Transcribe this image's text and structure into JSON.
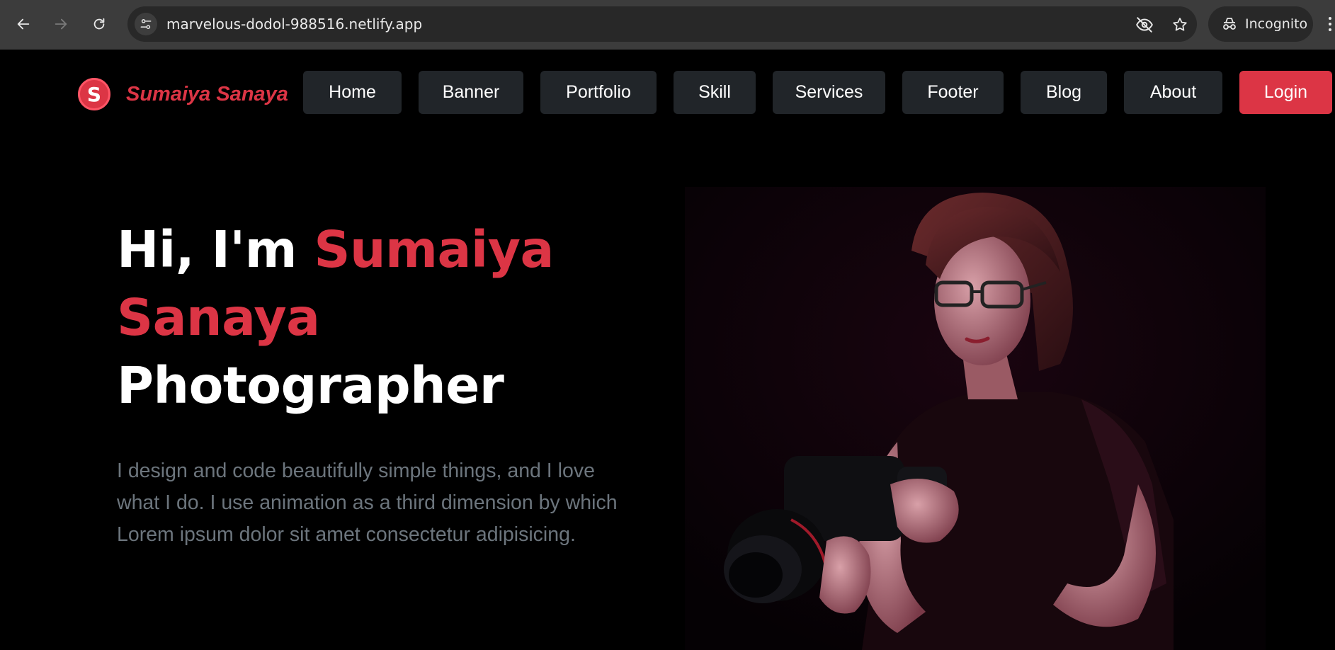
{
  "browser": {
    "url": "marvelous-dodol-988516.netlify.app",
    "incognito_label": "Incognito"
  },
  "header": {
    "logo_letter": "S",
    "brand_name": "Sumaiya Sanaya",
    "nav": [
      {
        "label": "Home"
      },
      {
        "label": "Banner"
      },
      {
        "label": "Portfolio"
      },
      {
        "label": "Skill"
      },
      {
        "label": "Services"
      },
      {
        "label": "Footer"
      },
      {
        "label": "Blog"
      },
      {
        "label": "About"
      }
    ],
    "login_label": "Login"
  },
  "hero": {
    "greeting": "Hi, I'm ",
    "name": "Sumaiya Sanaya",
    "role": "Photographer",
    "description": "I design and code beautifully simple things, and I love what I do. I use animation as a third dimension by which Lorem ipsum dolor sit amet consectetur adipisicing."
  },
  "colors": {
    "accent": "#dc3545",
    "nav_button_bg": "#212529",
    "text_muted": "#6c757d",
    "page_bg": "#000000"
  },
  "icons": {
    "back": "arrow-left-icon",
    "forward": "arrow-right-icon",
    "reload": "reload-icon",
    "site_info": "tune-icon",
    "eye_off": "eye-off-icon",
    "bookmark": "star-icon",
    "incognito": "incognito-icon"
  }
}
